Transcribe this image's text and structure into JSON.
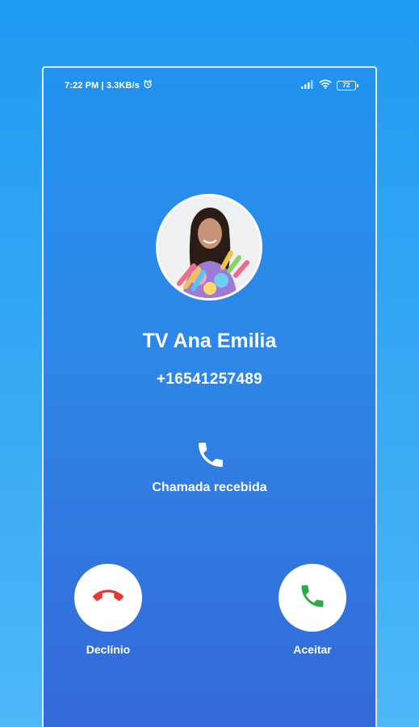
{
  "status_bar": {
    "time_info": "7:22 PM | 3.3KB/s",
    "battery_level": "72"
  },
  "caller": {
    "name": "TV Ana Emilia",
    "number": "+16541257489"
  },
  "call_status": {
    "label": "Chamada recebida",
    "icon": "phone-icon"
  },
  "actions": {
    "decline_label": "Declínio",
    "accept_label": "Aceitar",
    "decline_icon": "phone-hangup-icon",
    "accept_icon": "phone-answer-icon"
  },
  "colors": {
    "decline": "#e53935",
    "accept": "#2eaa4a",
    "background": "#2a8ae8"
  }
}
